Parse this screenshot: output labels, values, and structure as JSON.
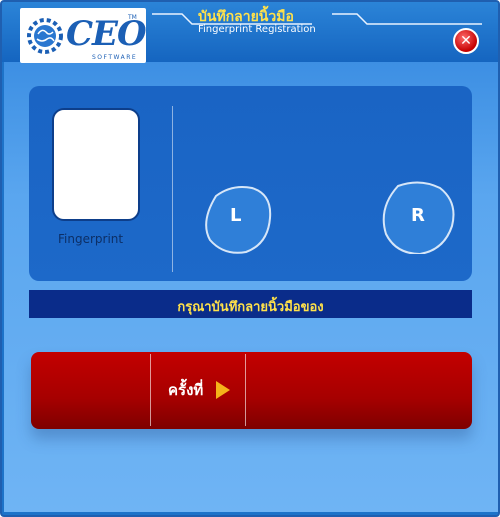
{
  "header": {
    "title": "บันทึกลายนิ้วมือ",
    "subtitle": "Fingerprint Registration",
    "logo": {
      "brand": "CEO",
      "tagline": "SOFTWARE",
      "trademark": "TM"
    },
    "close_icon": "close-icon"
  },
  "fingerprint": {
    "label": "Fingerprint"
  },
  "hands": {
    "left_label": "L",
    "right_label": "R"
  },
  "status": {
    "message": "กรุณาบันทึกลายนิ้วมือของ"
  },
  "action": {
    "round_label": "ครั้งที่",
    "arrow_icon": "play-arrow-icon"
  },
  "colors": {
    "accent_yellow": "#ffe14a",
    "panel_blue": "#1d69c9",
    "action_red": "#b00000"
  }
}
